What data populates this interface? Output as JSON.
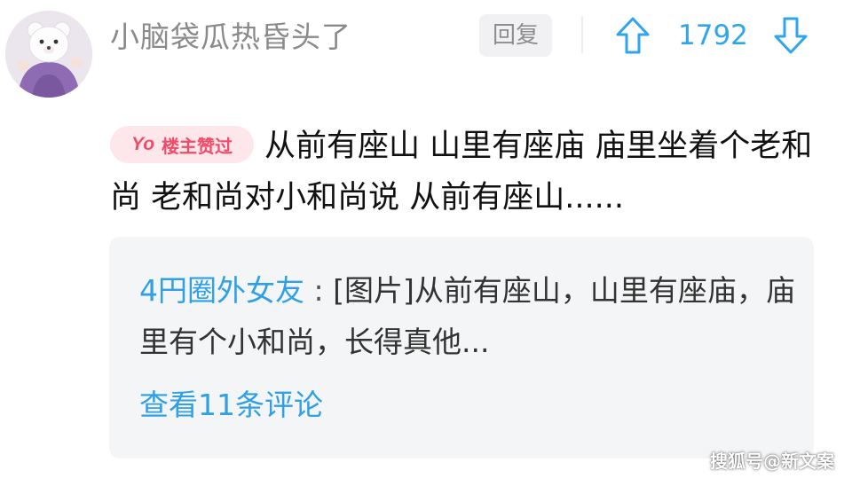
{
  "comment": {
    "username": "小脑袋瓜热昏头了",
    "reply_label": "回复",
    "vote_count": "1792",
    "op_badge": {
      "prefix": "Yo",
      "label": "楼主赞过"
    },
    "text": "从前有座山 山里有座庙 庙里坐着个老和尚 老和尚对小和尚说 从前有座山......"
  },
  "nested_reply": {
    "author": "4円圈外女友",
    "separator": ":",
    "text": "[图片]从前有座山，山里有座庙，庙里有个小和尚，长得真他...",
    "view_more_label": "查看11条评论"
  },
  "watermark": "搜狐号@新文案",
  "icons": {
    "upvote": "arrow-up-icon",
    "downvote": "arrow-down-icon"
  },
  "colors": {
    "accent_blue": "#2fa5ee",
    "badge_pink": "#f14b6a",
    "badge_bg": "#fde7ea",
    "reply_box_bg": "#f4f5f7"
  }
}
